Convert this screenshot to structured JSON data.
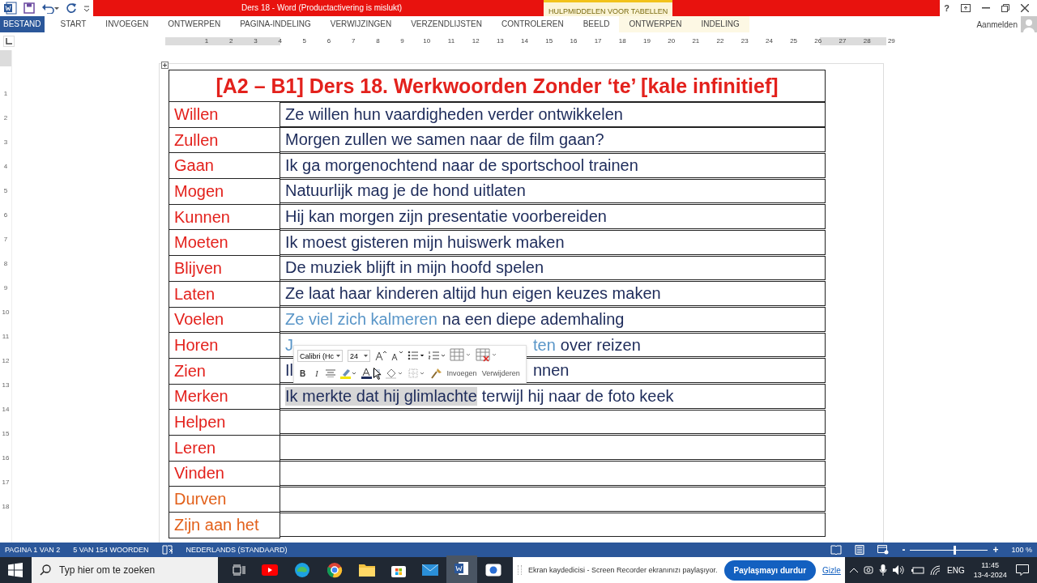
{
  "window": {
    "title": "Ders 18 -  Word (Productactivering is mislukt)",
    "context_group": "HULPMIDDELEN VOOR TABELLEN",
    "account": "Aanmelden",
    "help": "?"
  },
  "ribbon_tabs": [
    {
      "label": "BESTAND",
      "selected": true,
      "contextual": false
    },
    {
      "label": "START",
      "selected": false,
      "contextual": false
    },
    {
      "label": "INVOEGEN",
      "selected": false,
      "contextual": false
    },
    {
      "label": "ONTWERPEN",
      "selected": false,
      "contextual": false
    },
    {
      "label": "PAGINA-INDELING",
      "selected": false,
      "contextual": false
    },
    {
      "label": "VERWIJZINGEN",
      "selected": false,
      "contextual": false
    },
    {
      "label": "VERZENDLIJSTEN",
      "selected": false,
      "contextual": false
    },
    {
      "label": "CONTROLEREN",
      "selected": false,
      "contextual": false
    },
    {
      "label": "BEELD",
      "selected": false,
      "contextual": false
    },
    {
      "label": "ONTWERPEN",
      "selected": false,
      "contextual": true
    },
    {
      "label": "INDELING",
      "selected": false,
      "contextual": true
    }
  ],
  "ruler": {
    "numbers": [
      "1",
      "2",
      "3",
      "4",
      "5",
      "6",
      "7",
      "8",
      "9",
      "10",
      "11",
      "12",
      "13",
      "14",
      "15",
      "16",
      "17",
      "18",
      "19",
      "20",
      "21",
      "22",
      "23",
      "24",
      "25",
      "26",
      "27",
      "28",
      "29"
    ],
    "vertical_numbers": [
      "1",
      "2",
      "3",
      "4",
      "5",
      "6",
      "7",
      "8",
      "9",
      "10",
      "11",
      "12",
      "13",
      "14",
      "15",
      "16",
      "17",
      "18"
    ]
  },
  "document": {
    "title": "[A2 – B1] Ders 18. Werkwoorden Zonder ‘te’ [kale infinitief]",
    "rows": [
      {
        "verb": "Willen",
        "color": "#e3211c",
        "parts": [
          {
            "kind": "text",
            "text": "Ze willen hun vaardigheden verder ontwikkelen",
            "color": "#1d2b5a",
            "selected": false
          }
        ]
      },
      {
        "verb": "Zullen",
        "color": "#e3211c",
        "parts": [
          {
            "kind": "text",
            "text": "Morgen zullen we samen naar de film gaan?",
            "color": "#1d2b5a",
            "selected": false
          }
        ]
      },
      {
        "verb": "Gaan",
        "color": "#e3211c",
        "parts": [
          {
            "kind": "text",
            "text": "Ik ga morgenochtend naar de sportschool trainen",
            "color": "#1d2b5a",
            "selected": false
          }
        ]
      },
      {
        "verb": "Mogen",
        "color": "#e3211c",
        "parts": [
          {
            "kind": "text",
            "text": "Natuurlijk mag je de hond uitlaten",
            "color": "#1d2b5a",
            "selected": false
          }
        ]
      },
      {
        "verb": "Kunnen",
        "color": "#e3211c",
        "parts": [
          {
            "kind": "text",
            "text": "Hij kan morgen zijn presentatie voorbereiden",
            "color": "#1d2b5a",
            "selected": false
          }
        ]
      },
      {
        "verb": "Moeten",
        "color": "#e3211c",
        "parts": [
          {
            "kind": "text",
            "text": "Ik moest gisteren mijn huiswerk maken",
            "color": "#1d2b5a",
            "selected": false
          }
        ]
      },
      {
        "verb": "Blijven",
        "color": "#e3211c",
        "parts": [
          {
            "kind": "text",
            "text": "De muziek blijft in mijn hoofd spelen",
            "color": "#1d2b5a",
            "selected": false
          }
        ]
      },
      {
        "verb": "Laten",
        "color": "#e3211c",
        "parts": [
          {
            "kind": "text",
            "text": "Ze laat haar kinderen altijd hun eigen keuzes maken",
            "color": "#1d2b5a",
            "selected": false
          }
        ]
      },
      {
        "verb": "Voelen",
        "color": "#e3211c",
        "parts": [
          {
            "kind": "text",
            "text": "Ze viel zich kalmeren",
            "color": "#5a96c8",
            "selected": false
          },
          {
            "kind": "text",
            "text": "na een diepe ademhaling",
            "color": "#1d2b5a",
            "selected": false
          }
        ]
      },
      {
        "verb": "Horen",
        "color": "#e3211c",
        "parts": [
          {
            "kind": "text",
            "text": "J",
            "color": "#5a96c8",
            "selected": false
          },
          {
            "kind": "covered"
          },
          {
            "kind": "text",
            "text": "ten",
            "color": "#5a96c8",
            "selected": false
          },
          {
            "kind": "text",
            "text": "over reizen",
            "color": "#1d2b5a",
            "selected": false
          }
        ]
      },
      {
        "verb": "Zien",
        "color": "#e3211c",
        "parts": [
          {
            "kind": "text",
            "text": "Il",
            "color": "#1d2b5a",
            "selected": false
          },
          {
            "kind": "covered"
          },
          {
            "kind": "text",
            "text": "nnen",
            "color": "#1d2b5a",
            "selected": false
          }
        ]
      },
      {
        "verb": "Merken",
        "color": "#e3211c",
        "parts": [
          {
            "kind": "text",
            "text": "Ik merkte dat hij glimlachte",
            "color": "#1d2b5a",
            "selected": true
          },
          {
            "kind": "text",
            "text": "terwijl hij naar de foto keek",
            "color": "#1d2b5a",
            "selected": false
          }
        ]
      },
      {
        "verb": "Helpen",
        "color": "#e3211c",
        "parts": []
      },
      {
        "verb": "Leren",
        "color": "#e3211c",
        "parts": []
      },
      {
        "verb": "Vinden",
        "color": "#e3211c",
        "parts": []
      },
      {
        "verb": "Durven",
        "color": "#e2601a",
        "parts": []
      },
      {
        "verb": "Zijn aan het",
        "color": "#e2601a",
        "parts": []
      }
    ]
  },
  "mini_toolbar": {
    "font": "Calibri (Hc",
    "size": "24",
    "bold": "B",
    "italic": "I",
    "insert": "Invoegen",
    "delete": "Verwijderen"
  },
  "status_bar": {
    "page": "PAGINA 1 VAN 2",
    "words": "5 VAN 154 WOORDEN",
    "language": "NEDERLANDS (STANDAARD)",
    "zoom_out": "-",
    "zoom_in": "+",
    "zoom": "100 %",
    "zoom_level": {
      "level": 0.58
    }
  },
  "taskbar": {
    "search_placeholder": "Typ hier om te zoeken",
    "share_message": "Ekran kaydedicisi - Screen Recorder ekranınızı paylaşıyor.",
    "stop_button": "Paylaşmayı durdur",
    "hide_link": "Gizle",
    "language": "ENG",
    "time": "11:45",
    "date": "13-4-2024"
  }
}
